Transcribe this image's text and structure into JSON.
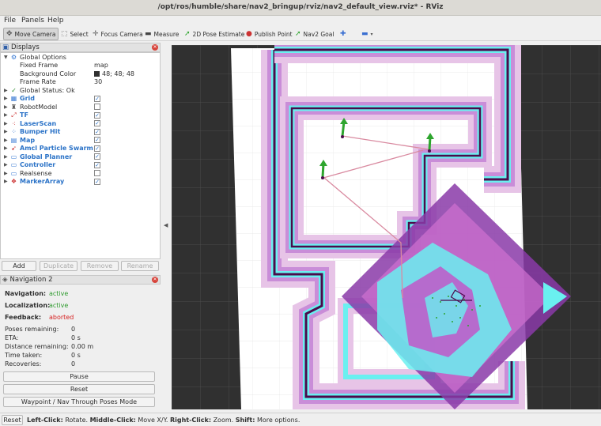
{
  "window": {
    "title": "/opt/ros/humble/share/nav2_bringup/rviz/nav2_default_view.rviz* - RViz"
  },
  "menu": [
    "File",
    "Panels",
    "Help"
  ],
  "toolbar": [
    {
      "label": "Move Camera",
      "icon": "move-camera-icon",
      "active": true
    },
    {
      "label": "Select",
      "icon": "select-icon"
    },
    {
      "label": "Focus Camera",
      "icon": "focus-camera-icon"
    },
    {
      "label": "Measure",
      "icon": "measure-icon"
    },
    {
      "label": "2D Pose Estimate",
      "icon": "pose-estimate-icon"
    },
    {
      "label": "Publish Point",
      "icon": "publish-point-icon"
    },
    {
      "label": "Nav2 Goal",
      "icon": "nav2-goal-icon"
    },
    {
      "label": "",
      "icon": "add-tool-icon"
    },
    {
      "label": "",
      "icon": "remove-tool-icon"
    }
  ],
  "displays": {
    "header": "Displays",
    "global_options": {
      "label": "Global Options",
      "fixed_frame_label": "Fixed Frame",
      "fixed_frame": "map",
      "background_color_label": "Background Color",
      "background_color": "48; 48; 48",
      "background_color_hex": "#303030",
      "frame_rate_label": "Frame Rate",
      "frame_rate": "30"
    },
    "global_status": "Global Status: Ok",
    "items": [
      {
        "label": "Grid",
        "checked": true,
        "highlight": true,
        "icon": "grid-icon"
      },
      {
        "label": "RobotModel",
        "checked": false,
        "highlight": false,
        "icon": "robot-model-icon"
      },
      {
        "label": "TF",
        "checked": true,
        "highlight": true,
        "icon": "tf-icon"
      },
      {
        "label": "LaserScan",
        "checked": true,
        "highlight": true,
        "icon": "laser-scan-icon"
      },
      {
        "label": "Bumper Hit",
        "checked": true,
        "highlight": true,
        "icon": "bumper-hit-icon"
      },
      {
        "label": "Map",
        "checked": true,
        "highlight": true,
        "icon": "map-icon"
      },
      {
        "label": "Amcl Particle Swarm",
        "checked": true,
        "highlight": true,
        "icon": "particle-swarm-icon"
      },
      {
        "label": "Global Planner",
        "checked": true,
        "highlight": true,
        "icon": "folder-icon"
      },
      {
        "label": "Controller",
        "checked": true,
        "highlight": true,
        "icon": "folder-icon"
      },
      {
        "label": "Realsense",
        "checked": false,
        "highlight": false,
        "icon": "folder-icon"
      },
      {
        "label": "MarkerArray",
        "checked": true,
        "highlight": true,
        "icon": "marker-array-icon"
      }
    ],
    "buttons": {
      "add": "Add",
      "duplicate": "Duplicate",
      "remove": "Remove",
      "rename": "Rename"
    }
  },
  "navigation": {
    "header": "Navigation 2",
    "navigation_label": "Navigation:",
    "navigation_value": "active",
    "localization_label": "Localization:",
    "localization_value": "active",
    "feedback_label": "Feedback:",
    "feedback_value": "aborted",
    "active_color": "#2e9b2e",
    "aborted_color": "#d62222",
    "poses_remaining_label": "Poses remaining:",
    "poses_remaining": "0",
    "eta_label": "ETA:",
    "eta": "0 s",
    "distance_label": "Distance remaining:",
    "distance": "0.00 m",
    "time_taken_label": "Time taken:",
    "time_taken": "0 s",
    "recoveries_label": "Recoveries:",
    "recoveries": "0",
    "pause": "Pause",
    "reset": "Reset",
    "waypoint": "Waypoint / Nav Through Poses Mode"
  },
  "status": {
    "reset": "Reset",
    "left": "Left-Click:",
    "left_text": "Rotate.",
    "middle": "Middle-Click:",
    "middle_text": "Move X/Y.",
    "right": "Right-Click:",
    "right_text": "Zoom.",
    "shift": "Shift:",
    "shift_text": "More options."
  }
}
